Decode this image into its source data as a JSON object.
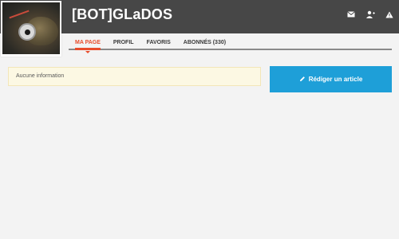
{
  "profile": {
    "username": "[BOT]GLaDOS"
  },
  "header_icons": [
    "envelope-icon",
    "add-user-icon",
    "warning-icon"
  ],
  "tabs": [
    {
      "label": "MA PAGE",
      "active": true
    },
    {
      "label": "PROFIL",
      "active": false
    },
    {
      "label": "FAVORIS",
      "active": false
    },
    {
      "label": "ABONNÉS (330)",
      "active": false
    }
  ],
  "notice": {
    "text": "Aucune information"
  },
  "actions": {
    "write_article_label": "Rédiger un article"
  },
  "colors": {
    "header_bg": "#474747",
    "accent": "#e84c2b",
    "button_blue": "#1e9fd8",
    "notice_bg": "#fcf8e3"
  }
}
